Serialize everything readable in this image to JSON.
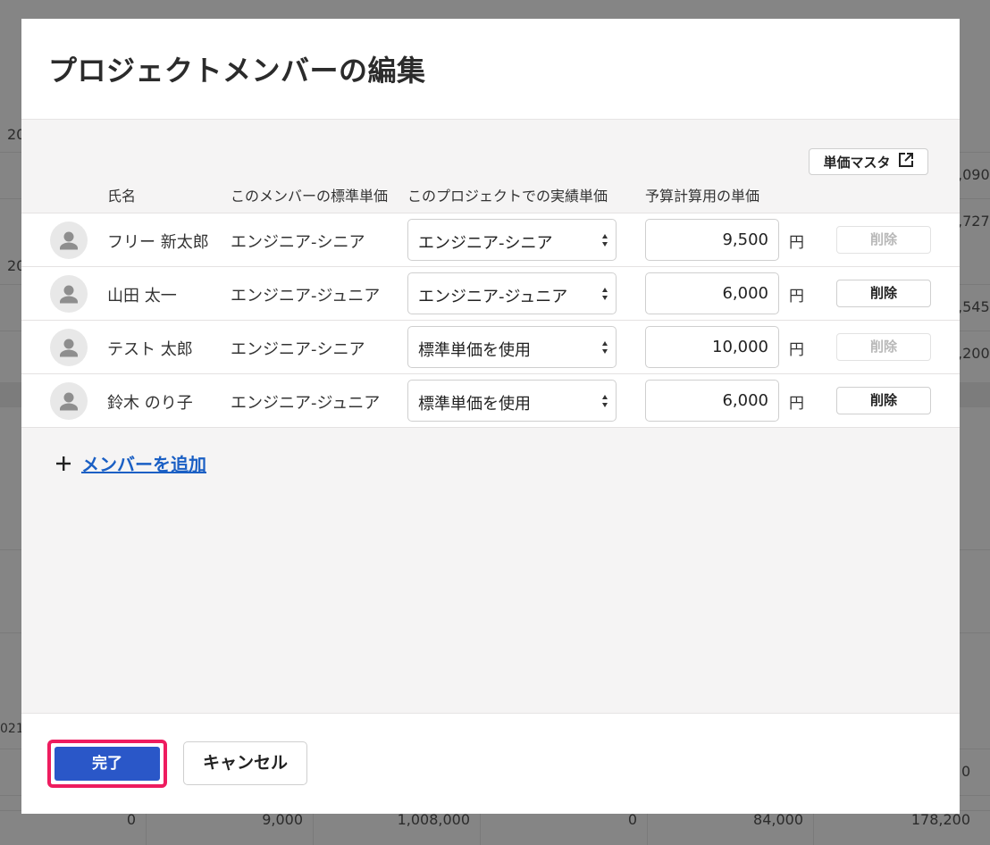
{
  "background": {
    "fragments": [
      "20",
      "20",
      ",090",
      ",727",
      ",545",
      ",200",
      "021",
      "0"
    ],
    "bottom_row": [
      "0",
      "9,000",
      "1,008,000",
      "0",
      "84,000",
      "178,200"
    ]
  },
  "modal": {
    "title": "プロジェクトメンバーの編集",
    "master_button": {
      "label": "単価マスタ",
      "icon": "external-link-icon"
    },
    "columns": {
      "name": "氏名",
      "standard_rate": "このメンバーの標準単価",
      "project_rate": "このプロジェクトでの実績単価",
      "budget_rate": "予算計算用の単価"
    },
    "members": [
      {
        "name": "フリー 新太郎",
        "standard_rate": "エンジニア-シニア",
        "project_rate": "エンジニア-シニア",
        "budget_rate": "9,500",
        "unit": "円",
        "delete_label": "削除",
        "delete_enabled": false
      },
      {
        "name": "山田 太一",
        "standard_rate": "エンジニア-ジュニア",
        "project_rate": "エンジニア-ジュニア",
        "budget_rate": "6,000",
        "unit": "円",
        "delete_label": "削除",
        "delete_enabled": true
      },
      {
        "name": "テスト 太郎",
        "standard_rate": "エンジニア-シニア",
        "project_rate": "標準単価を使用",
        "budget_rate": "10,000",
        "unit": "円",
        "delete_label": "削除",
        "delete_enabled": false
      },
      {
        "name": "鈴木 のり子",
        "standard_rate": "エンジニア-ジュニア",
        "project_rate": "標準単価を使用",
        "budget_rate": "6,000",
        "unit": "円",
        "delete_label": "削除",
        "delete_enabled": true
      }
    ],
    "add_member_label": "メンバーを追加",
    "footer": {
      "done_label": "完了",
      "cancel_label": "キャンセル"
    }
  },
  "colors": {
    "primary": "#2a57c8",
    "highlight": "#ee1c5f",
    "link": "#1a5fc4",
    "body_bg": "#f5f4f4"
  }
}
